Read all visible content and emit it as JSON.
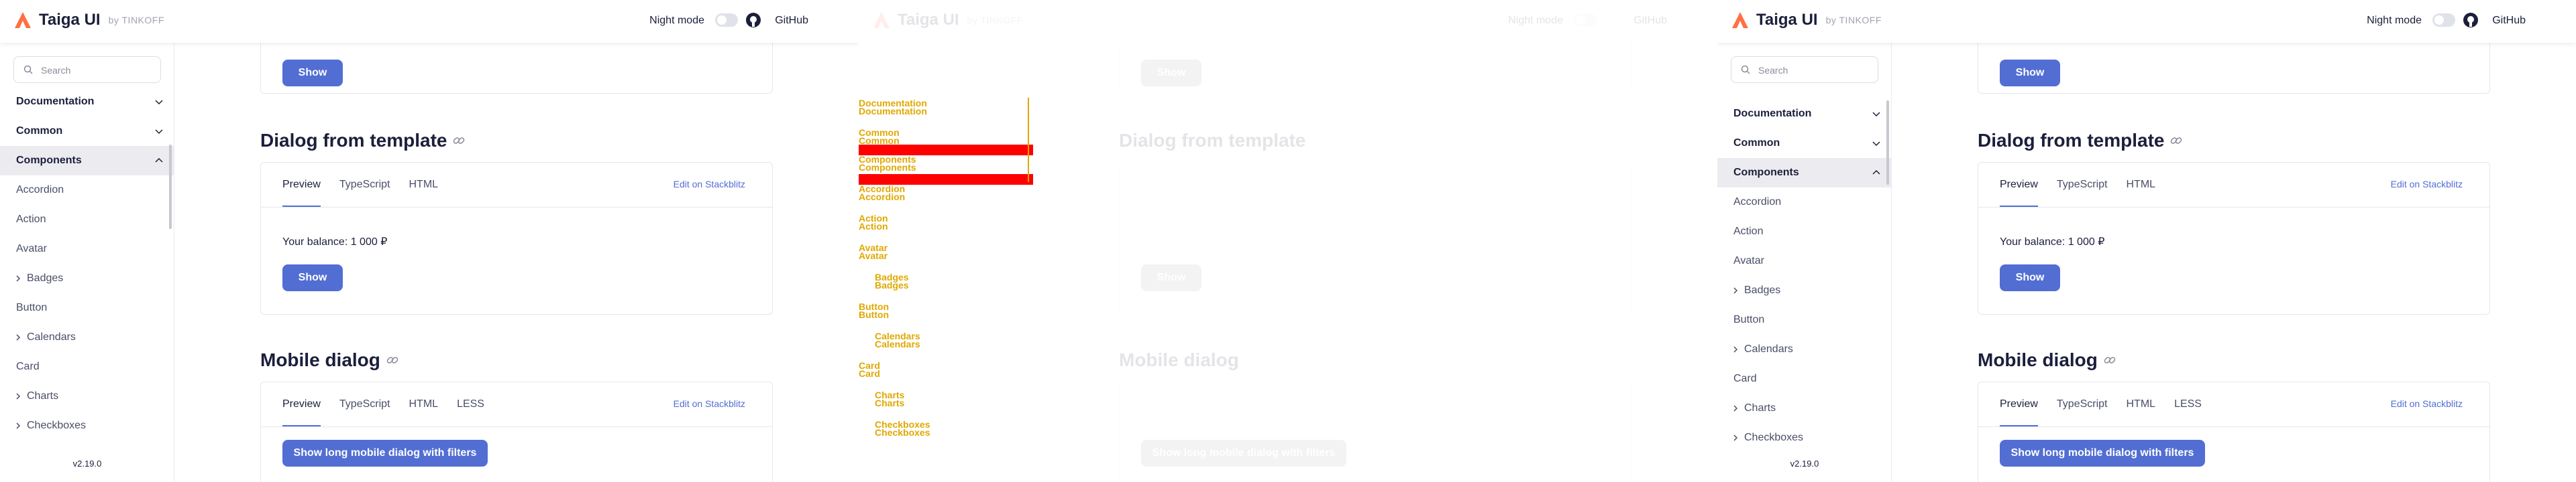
{
  "header": {
    "brand": "Taiga UI",
    "by": "by TINKOFF",
    "night_mode_label": "Night mode",
    "github_label": "GitHub"
  },
  "sidebar": {
    "search_placeholder": "Search",
    "sections": [
      {
        "label": "Documentation",
        "expanded": false
      },
      {
        "label": "Common",
        "expanded": false
      },
      {
        "label": "Components",
        "expanded": true
      }
    ],
    "items": [
      {
        "label": "Accordion",
        "expandable": false
      },
      {
        "label": "Action",
        "expandable": false
      },
      {
        "label": "Avatar",
        "expandable": false
      },
      {
        "label": "Badges",
        "expandable": true
      },
      {
        "label": "Button",
        "expandable": false
      },
      {
        "label": "Calendars",
        "expandable": true
      },
      {
        "label": "Card",
        "expandable": false
      },
      {
        "label": "Charts",
        "expandable": true
      },
      {
        "label": "Checkboxes",
        "expandable": true
      }
    ],
    "version": "v2.19.0"
  },
  "content": {
    "top_card_button": "Show",
    "dialog_template": {
      "title": "Dialog from template",
      "tabs": [
        "Preview",
        "TypeScript",
        "HTML"
      ],
      "stackblitz": "Edit on Stackblitz",
      "balance_text": "Your balance: 1 000 ₽",
      "button": "Show"
    },
    "mobile_dialog": {
      "title": "Mobile dialog",
      "tabs": [
        "Preview",
        "TypeScript",
        "HTML",
        "LESS"
      ],
      "stackblitz": "Edit on Stackblitz",
      "button": "Show long mobile dialog with filters"
    }
  },
  "colors": {
    "accent": "#526ed3",
    "brand_orange": "#ff7043",
    "overlay_yellow": "#e0a800",
    "overlay_red": "#ff0000"
  }
}
